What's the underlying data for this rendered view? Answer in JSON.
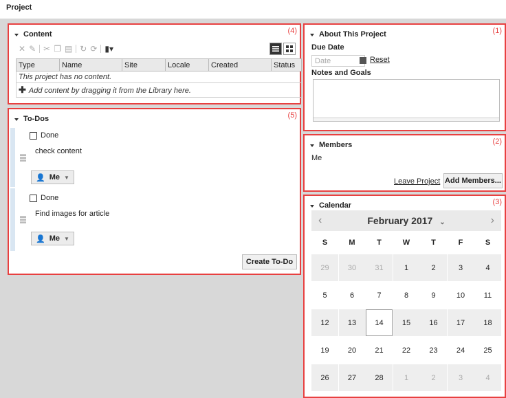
{
  "page": {
    "title": "Project"
  },
  "content_panel": {
    "header": "Content",
    "number": "(4)",
    "columns": [
      "Type",
      "Name",
      "Site",
      "Locale",
      "Created",
      "Status"
    ],
    "empty_message": "This project has no content.",
    "add_hint": "Add content by dragging it from the Library here."
  },
  "todos_panel": {
    "header": "To-Dos",
    "number": "(5)",
    "items": [
      {
        "done_label": "Done",
        "text": "check content",
        "assignee": "Me"
      },
      {
        "done_label": "Done",
        "text": "Find images for article",
        "assignee": "Me"
      }
    ],
    "create_button": "Create To-Do"
  },
  "about_panel": {
    "header": "About This Project",
    "number": "(1)",
    "due_date_label": "Due Date",
    "date_placeholder": "Date",
    "reset_link": "Reset",
    "notes_label": "Notes and Goals"
  },
  "members_panel": {
    "header": "Members",
    "number": "(2)",
    "member": "Me",
    "leave_link": "Leave Project",
    "add_button": "Add Members..."
  },
  "calendar_panel": {
    "header": "Calendar",
    "number": "(3)",
    "month_label": "February 2017",
    "weekdays": [
      "S",
      "M",
      "T",
      "W",
      "T",
      "F",
      "S"
    ],
    "weeks": [
      [
        "29",
        "30",
        "31",
        "1",
        "2",
        "3",
        "4"
      ],
      [
        "5",
        "6",
        "7",
        "8",
        "9",
        "10",
        "11"
      ],
      [
        "12",
        "13",
        "14",
        "15",
        "16",
        "17",
        "18"
      ],
      [
        "19",
        "20",
        "21",
        "22",
        "23",
        "24",
        "25"
      ],
      [
        "26",
        "27",
        "28",
        "1",
        "2",
        "3",
        "4"
      ]
    ],
    "today": "14"
  }
}
